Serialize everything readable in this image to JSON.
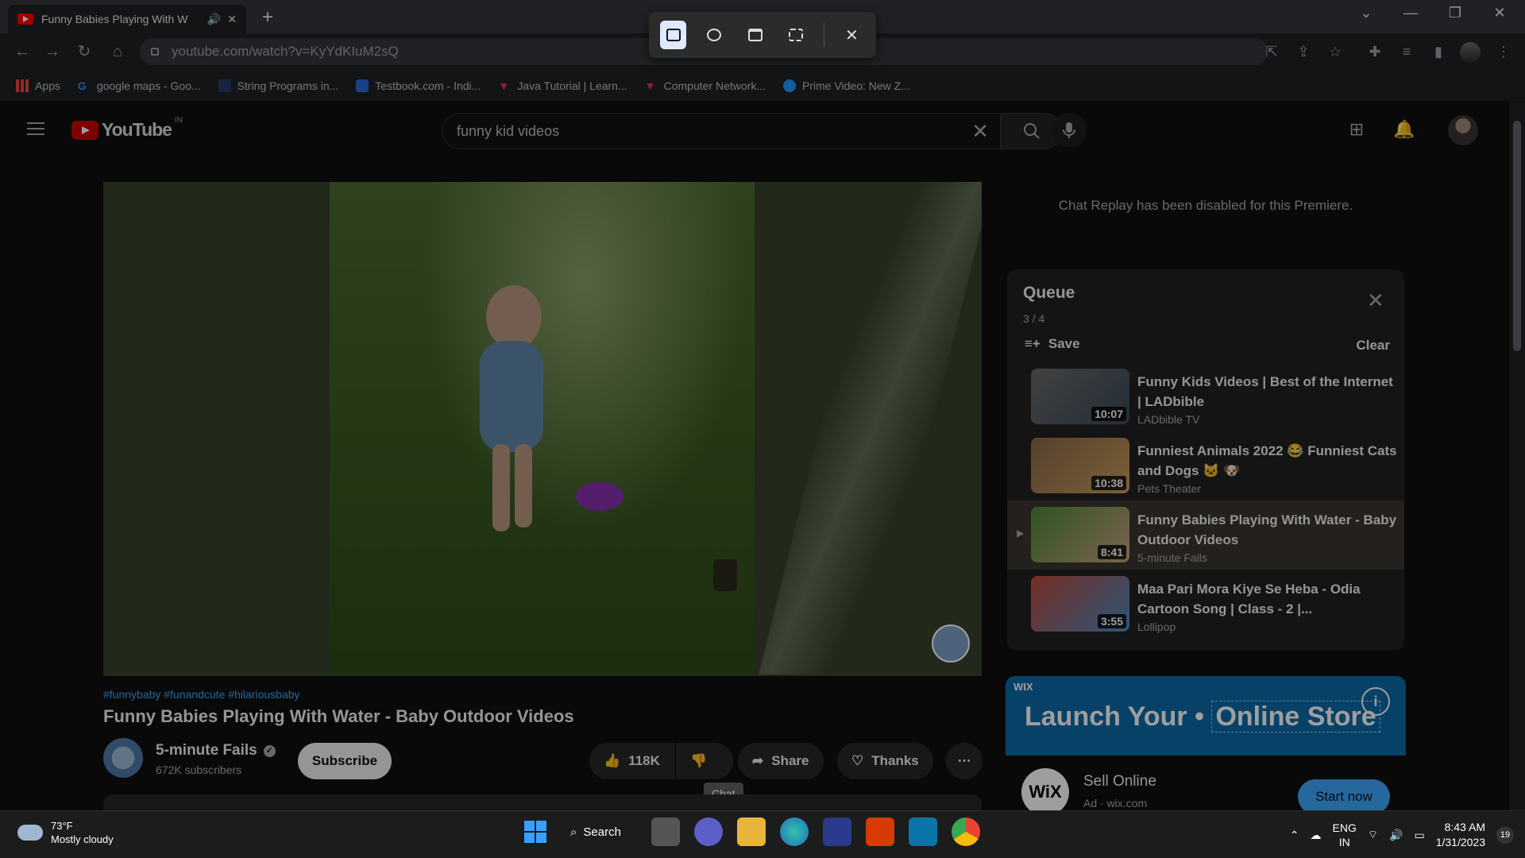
{
  "browser": {
    "tab_title": "Funny Babies Playing With W",
    "url": "youtube.com/watch?v=KyYdKIuM2sQ",
    "bookmarks": [
      {
        "label": "Apps",
        "icon": "apps-grid-icon"
      },
      {
        "label": "google maps - Goo...",
        "icon": "google-icon"
      },
      {
        "label": "String Programs in...",
        "icon": "site-icon"
      },
      {
        "label": "Testbook.com - Indi...",
        "icon": "testbook-icon"
      },
      {
        "label": "Java Tutorial | Learn...",
        "icon": "tutorialspoint-icon"
      },
      {
        "label": "Computer Network...",
        "icon": "tutorialspoint-icon"
      },
      {
        "label": "Prime Video: New Z...",
        "icon": "prime-video-icon"
      }
    ]
  },
  "youtube": {
    "region": "IN",
    "search_query": "funny kid videos",
    "video": {
      "hashtags": "#funnybaby #funandcute #hilariousbaby",
      "title": "Funny Babies Playing With Water - Baby Outdoor Videos",
      "channel": "5-minute Fails",
      "subscribers": "672K subscribers",
      "subscribe_label": "Subscribe",
      "likes": "118K",
      "share_label": "Share",
      "thanks_label": "Thanks",
      "tooltip": "Chat"
    },
    "chat_replay": "Chat Replay has been disabled for this Premiere.",
    "queue": {
      "title": "Queue",
      "count": "3 / 4",
      "save_label": "Save",
      "clear_label": "Clear",
      "items": [
        {
          "title": "Funny Kids Videos | Best of the Internet | LADbible",
          "channel": "LADbible TV",
          "duration": "10:07",
          "current": false
        },
        {
          "title": "Funniest Animals 2022 😂 Funniest Cats and Dogs 🐱 🐶",
          "channel": "Pets Theater",
          "duration": "10:38",
          "current": false
        },
        {
          "title": "Funny Babies Playing With Water - Baby Outdoor Videos",
          "channel": "5-minute Fails",
          "duration": "8:41",
          "current": true
        },
        {
          "title": "Maa Pari Mora Kiye Se Heba - Odia Cartoon Song | Class - 2 |...",
          "channel": "Lollipop",
          "duration": "3:55",
          "current": false
        }
      ]
    },
    "ad": {
      "brand": "WIX",
      "headline_1": "Launch Your",
      "headline_2": "Online Store",
      "logo_text": "WiX",
      "title": "Sell Online",
      "domain": "Ad · wix.com",
      "cta": "Start now"
    }
  },
  "taskbar": {
    "temperature": "73°F",
    "condition": "Mostly cloudy",
    "search_label": "Search",
    "lang_1": "ENG",
    "lang_2": "IN",
    "time": "8:43 AM",
    "date": "1/31/2023",
    "notifications": "19"
  },
  "colors": {
    "youtube_red": "#ff0000",
    "link_blue": "#3ea6ff",
    "ad_blue": "#0e6aa8"
  }
}
